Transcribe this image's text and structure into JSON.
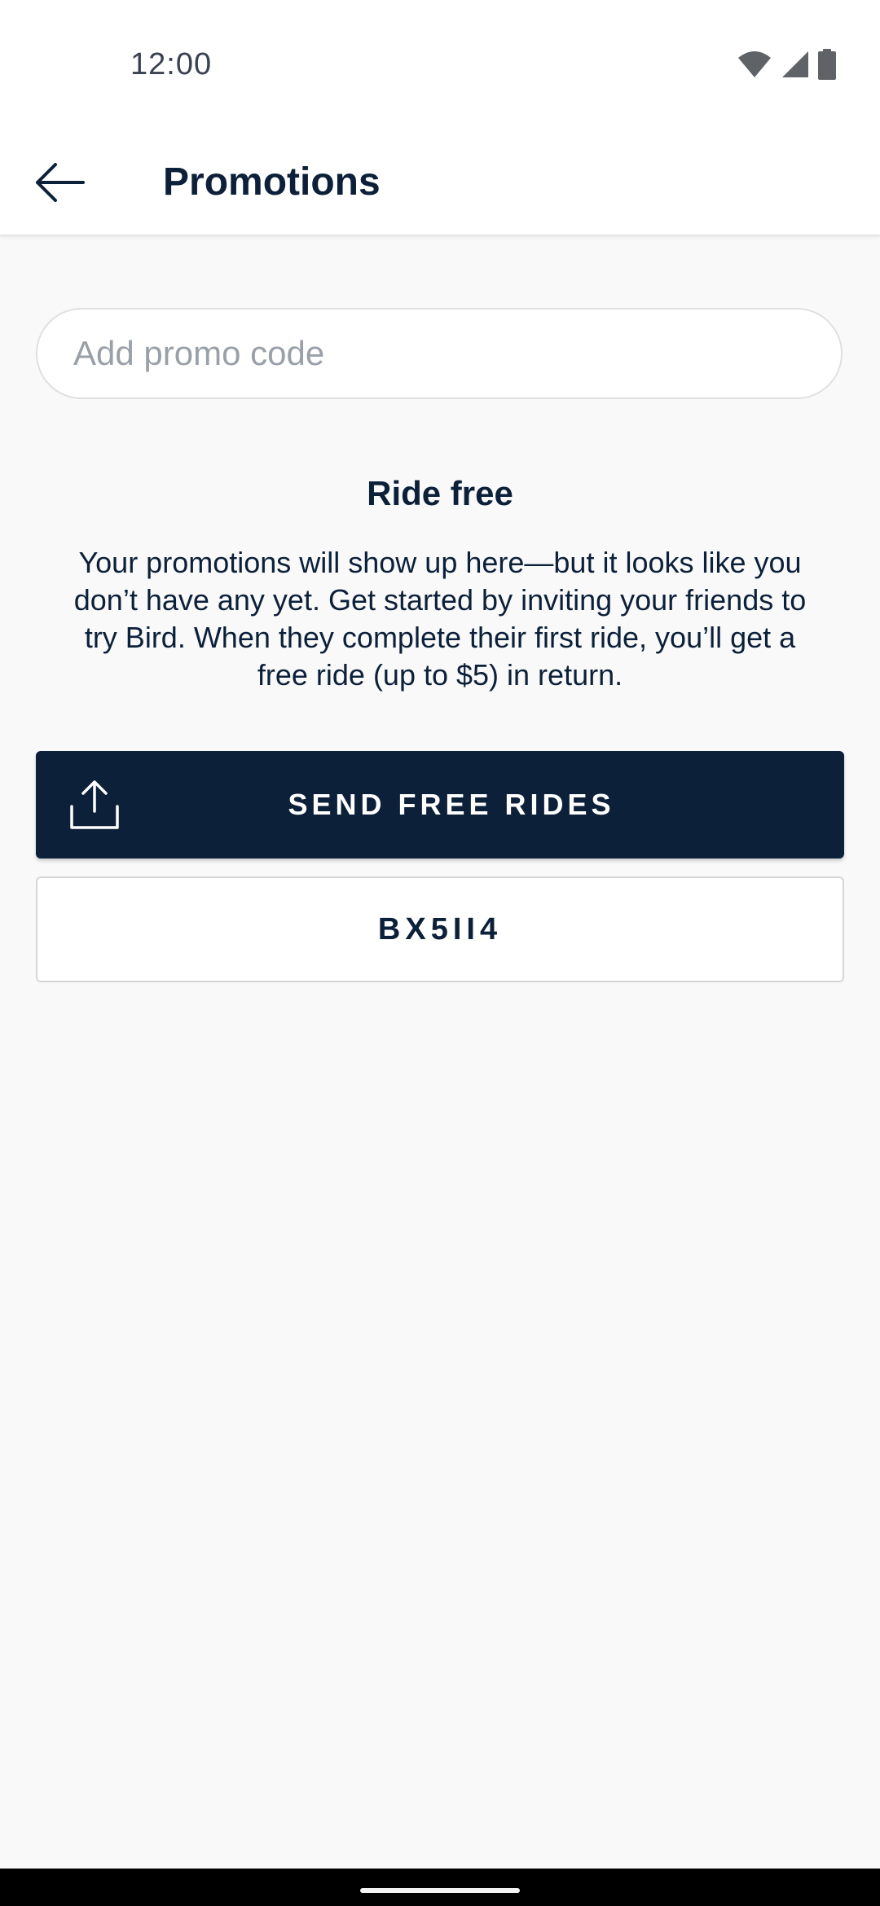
{
  "status_bar": {
    "time": "12:00"
  },
  "header": {
    "title": "Promotions",
    "back_icon": "arrow-left-icon"
  },
  "promo": {
    "placeholder": "Add promo code",
    "value": ""
  },
  "info": {
    "heading": "Ride free",
    "body": "Your promotions will show up here—but it looks like you don’t have any yet. Get started by inviting your friends to try Bird. When they complete their first ride, you’ll get a free ride (up to $5) in return."
  },
  "actions": {
    "send_label": "SEND FREE RIDES",
    "send_icon": "share-icon",
    "code_label": "BX5II4"
  },
  "colors": {
    "primary": "#0c2039",
    "background": "#f9f9f9",
    "surface": "#ffffff",
    "placeholder": "#9aa0a8"
  }
}
